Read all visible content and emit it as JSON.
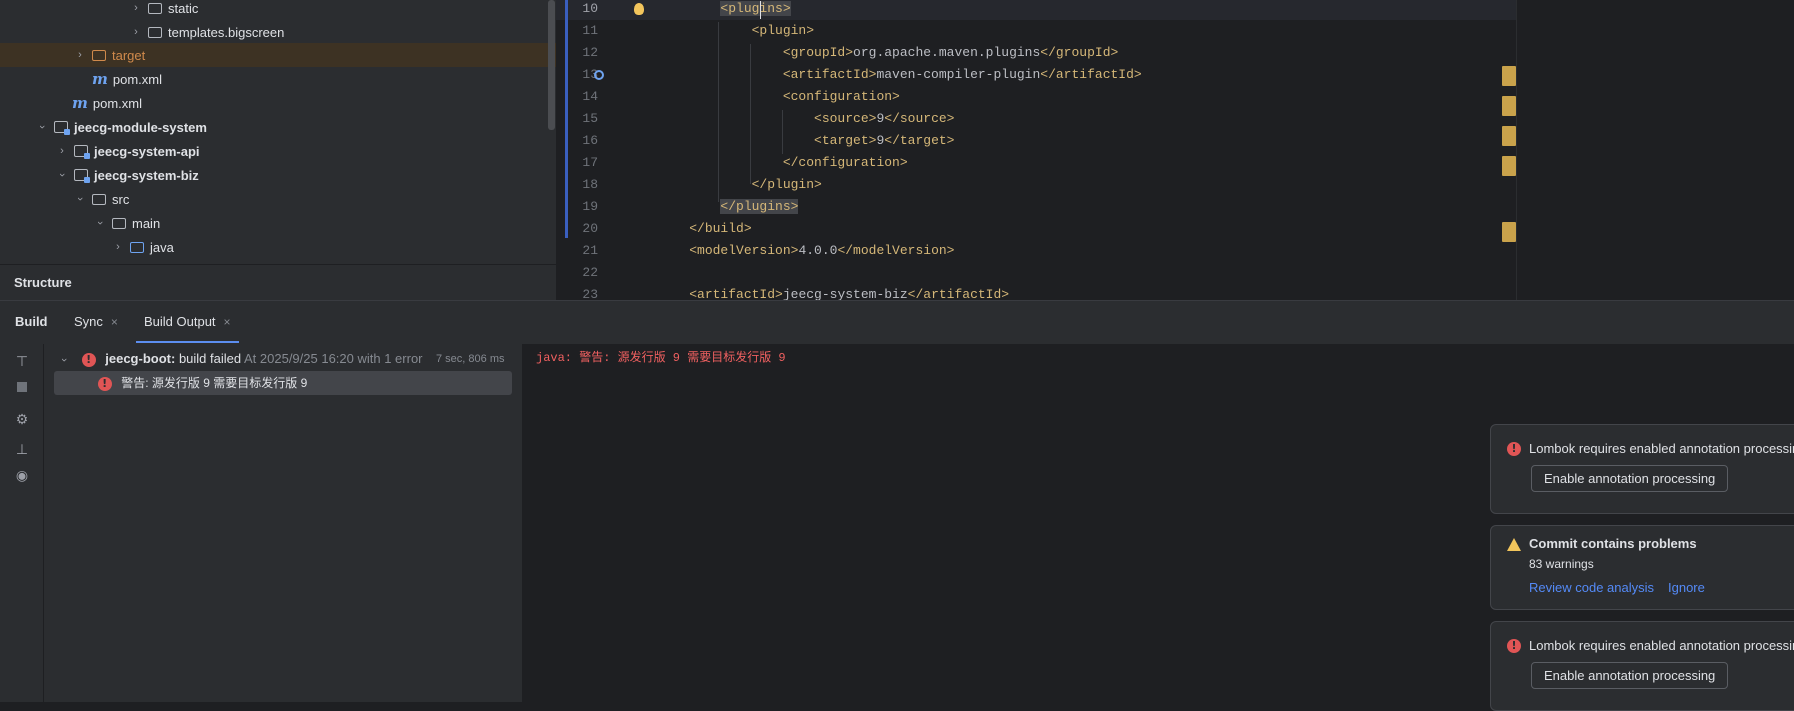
{
  "project_tree": {
    "items": [
      {
        "label": "static"
      },
      {
        "label": "templates.bigscreen"
      },
      {
        "label": "target"
      },
      {
        "label": "pom.xml"
      },
      {
        "label": "pom.xml"
      },
      {
        "label": "jeecg-module-system"
      },
      {
        "label": "jeecg-system-api"
      },
      {
        "label": "jeecg-system-biz"
      },
      {
        "label": "src"
      },
      {
        "label": "main"
      },
      {
        "label": "java"
      }
    ],
    "maven_icon_glyph": "m"
  },
  "structure": {
    "title": "Structure"
  },
  "editor": {
    "lines": [
      {
        "num": "10",
        "pre": "        ",
        "tag": "<plugins>",
        "text": "",
        "post": ""
      },
      {
        "num": "11",
        "pre": "            ",
        "tag": "<plugin>",
        "text": "",
        "post": ""
      },
      {
        "num": "12",
        "pre": "                ",
        "tag": "<groupId>",
        "text": "org.apache.maven.plugins",
        "post": "</groupId>"
      },
      {
        "num": "13",
        "pre": "                ",
        "tag": "<artifactId>",
        "text": "maven-compiler-plugin",
        "post": "</artifactId>"
      },
      {
        "num": "14",
        "pre": "                ",
        "tag": "<configuration>",
        "text": "",
        "post": ""
      },
      {
        "num": "15",
        "pre": "                    ",
        "tag": "<source>",
        "text": "9",
        "post": "</source>"
      },
      {
        "num": "16",
        "pre": "                    ",
        "tag": "<target>",
        "text": "9",
        "post": "</target>"
      },
      {
        "num": "17",
        "pre": "                ",
        "tag": "</configuration>",
        "text": "",
        "post": ""
      },
      {
        "num": "18",
        "pre": "            ",
        "tag": "</plugin>",
        "text": "",
        "post": ""
      },
      {
        "num": "19",
        "pre": "        ",
        "tag": "</plugins>",
        "text": "",
        "post": ""
      },
      {
        "num": "20",
        "pre": "    ",
        "tag": "</build>",
        "text": "",
        "post": ""
      },
      {
        "num": "21",
        "pre": "    ",
        "tag": "<modelVersion>",
        "text": "4.0.0",
        "post": "</modelVersion>"
      },
      {
        "num": "22",
        "pre": "",
        "tag": "",
        "text": "",
        "post": ""
      },
      {
        "num": "23",
        "pre": "    ",
        "tag": "<artifactId>",
        "text": "jeecg-system-biz",
        "post": "</artifactId>"
      }
    ],
    "accent_color": "#c9a24b"
  },
  "build": {
    "tabs": [
      {
        "label": "Build"
      },
      {
        "label": "Sync"
      },
      {
        "label": "Build Output"
      }
    ],
    "close_glyph": "×",
    "tree": {
      "root_name": "jeecg-boot:",
      "root_status": "build failed",
      "root_time": "At 2025/9/25 16:20 with 1 error",
      "duration": "7 sec, 806 ms",
      "child": "警告: 源发行版 9 需要目标发行版 9"
    },
    "output_line": "java: 警告: 源发行版 9 需要目标发行版 9"
  },
  "notifications": [
    {
      "title": "Lombok requires enabled annotation processing",
      "button": "Enable annotation processing"
    },
    {
      "title": "Commit contains problems",
      "detail": "83 warnings",
      "link1": "Review code analysis",
      "link2": "Ignore"
    },
    {
      "title": "Lombok requires enabled annotation processing",
      "button": "Enable annotation processing"
    }
  ],
  "colors": {
    "error": "#e05555",
    "warning": "#f2c55c",
    "link": "#548af7",
    "tag": "#d5b778"
  }
}
